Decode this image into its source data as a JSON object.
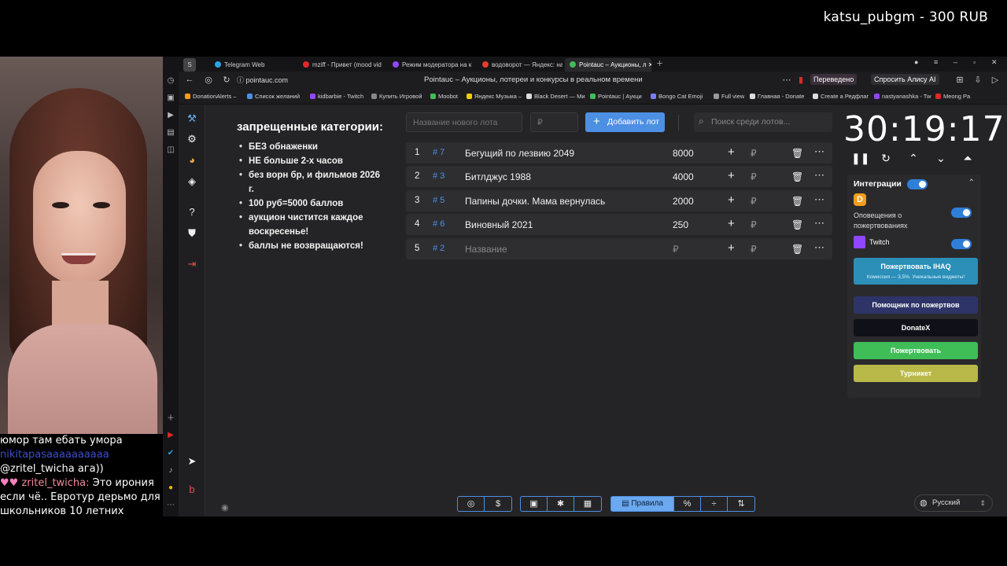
{
  "overlay": {
    "title": "katsu_pubgm - 300 RUB"
  },
  "chat": [
    {
      "nick": "",
      "text": "юмор там ебать умора"
    },
    {
      "nick": "nikitapasaaaaaaaaaa",
      "text": ""
    },
    {
      "nick": "",
      "text": "@zritel_twicha ага))"
    },
    {
      "nick": "zritel_twicha:",
      "text": "Это ирония"
    },
    {
      "nick": "",
      "text": "если чё.. Евротур дерьмо для"
    },
    {
      "nick": "",
      "text": "школьников 10 летних"
    }
  ],
  "browser": {
    "tabs": [
      {
        "label": "Telegram Web",
        "color": "#2aa3e0"
      },
      {
        "label": "mziff - Привет (mood vid",
        "color": "#e02828"
      },
      {
        "label": "Режим модератора на к",
        "color": "#9146ff"
      },
      {
        "label": "водоворот — Яндекс: наш",
        "color": "#e83b2b"
      },
      {
        "label": "Pointauc – Аукционы, л",
        "color": "#3fbd57"
      }
    ],
    "url": "pointauc.com",
    "page_title": "Pointauc – Аукционы, лотереи и конкурсы в реальном времени",
    "translated": "Переведено",
    "ask_alice": "Спросить Алису AI",
    "bookmarks": [
      "DonationAlerts –",
      "Список желаний",
      "kidbarbie - Twitch",
      "Купить Игровой",
      "Moobot",
      "Яндекс Музыка –",
      "Black Desert — Ми",
      "Pointauc | Аукци",
      "Bongo Cat Emoji",
      "Full view",
      "Главная - Donate",
      "Create a Редфлаг",
      "nastyanashka - Tw",
      "Meong Pa"
    ]
  },
  "rules": {
    "title": "запрещенные категории:",
    "items": [
      "БЕЗ обнаженки",
      "НЕ больше 2-х часов",
      "без ворн бр, и фильмов 2026 г.",
      "100 руб=5000 баллов",
      "аукцион чистится каждое воскресенье!",
      "баллы не возвращаются!"
    ]
  },
  "lot_form": {
    "name_placeholder": "Название нового лота",
    "price_placeholder": "₽",
    "add_label": "Добавить лот",
    "search_placeholder": "Поиск среди лотов..."
  },
  "lots": [
    {
      "n": "1",
      "id": "# 7",
      "name": "Бегущий по лезвию 2049",
      "amount": "8000",
      "placeholder": false
    },
    {
      "n": "2",
      "id": "# 3",
      "name": "Битлджус 1988",
      "amount": "4000",
      "placeholder": false
    },
    {
      "n": "3",
      "id": "# 5",
      "name": "Папины дочки. Мама вернулась",
      "amount": "2000",
      "placeholder": false
    },
    {
      "n": "4",
      "id": "# 6",
      "name": "Виновный 2021",
      "amount": "250",
      "placeholder": false
    },
    {
      "n": "5",
      "id": "# 2",
      "name": "Название",
      "amount": "₽",
      "placeholder": true
    }
  ],
  "lot_row_rub": "₽",
  "timer": {
    "value": "30:19:17"
  },
  "integrations": {
    "title": "Интеграции",
    "donationalerts_label": "Оповещения о пожертвованиях",
    "twitch_label": "Twitch",
    "ihaq_label": "Пожертвовать IHAQ",
    "ihaq_sub": "Комиссия — 3,5%. Уникальные виджеты!",
    "helper_label": "Помощник по пожертвов",
    "donatex_label": "DonateX",
    "donate_label": "Пожертвовать",
    "turnstile_label": "Турникет"
  },
  "toolbar": {
    "rules_label": "Правила"
  },
  "language": "Русский"
}
